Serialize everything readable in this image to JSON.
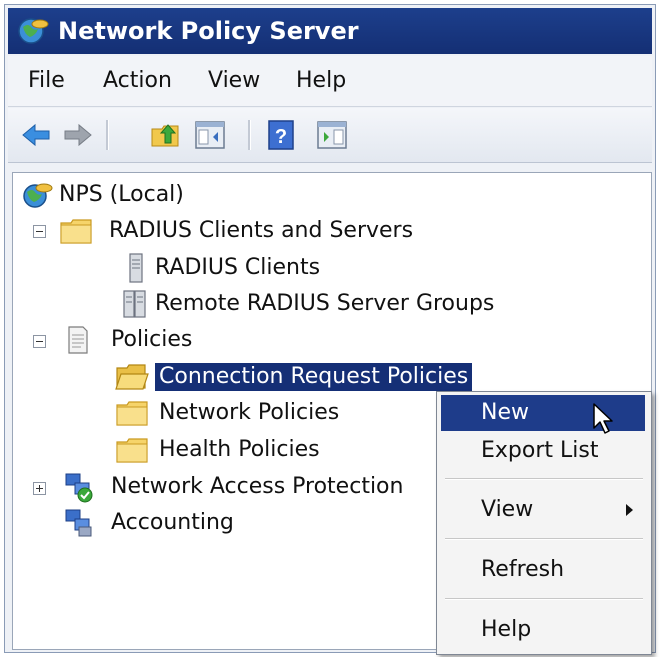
{
  "window": {
    "title": "Network Policy Server"
  },
  "menu": {
    "items": [
      "File",
      "Action",
      "View",
      "Help"
    ]
  },
  "toolbar": {
    "buttons": [
      "back-icon",
      "forward-icon",
      "up-folder-icon",
      "show-hide-tree-icon",
      "help-icon",
      "action-pane-icon"
    ]
  },
  "tree": {
    "root": "NPS (Local)",
    "radius_group": "RADIUS Clients and Servers",
    "radius_clients": "RADIUS Clients",
    "remote_groups": "Remote RADIUS Server Groups",
    "policies": "Policies",
    "connection_request": "Connection Request Policies",
    "network_policies": "Network Policies",
    "health_policies": "Health Policies",
    "nap": "Network Access Protection",
    "accounting": "Accounting"
  },
  "context_menu": {
    "new": "New",
    "export_list": "Export List",
    "view": "View",
    "refresh": "Refresh",
    "help": "Help"
  },
  "colors": {
    "title_bar": "#1a3884",
    "selection": "#152f76",
    "menu_highlight": "#1e3c8a"
  }
}
